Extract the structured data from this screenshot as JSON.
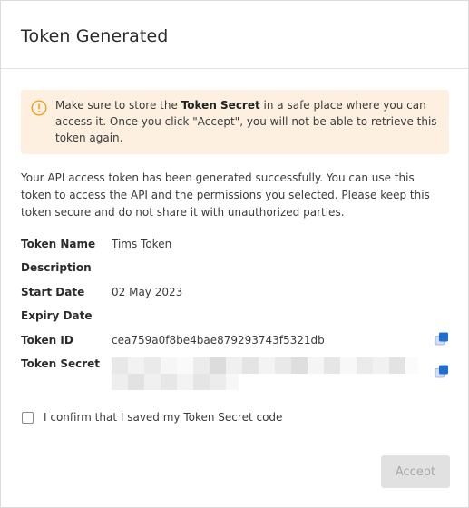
{
  "dialog": {
    "title": "Token Generated"
  },
  "warning": {
    "icon": "warning-circle-icon",
    "color": "#f0a020",
    "background": "#fdf0e0",
    "text_before": "Make sure to store the ",
    "text_bold": "Token Secret",
    "text_after": " in a safe place where you can access it. Once you click \"Accept\", you will not be able to retrieve this token again."
  },
  "intro": "Your API access token has been generated successfully. You can use this token to access the API and the permissions you selected. Please keep this token secure and do not share it with unauthorized parties.",
  "fields": {
    "token_name": {
      "label": "Token Name",
      "value": "Tims Token"
    },
    "description": {
      "label": "Description",
      "value": ""
    },
    "start_date": {
      "label": "Start Date",
      "value": "02 May 2023"
    },
    "expiry_date": {
      "label": "Expiry Date",
      "value": ""
    },
    "token_id": {
      "label": "Token ID",
      "value": "cea759a0f8be4bae879293743f5321db"
    },
    "token_secret": {
      "label": "Token Secret",
      "value": ""
    }
  },
  "copy_icon": {
    "name": "copy-icon",
    "accent": "#1f6fd1"
  },
  "confirm": {
    "label": "I confirm that I saved my Token Secret code",
    "checked": false
  },
  "accept_button": {
    "label": "Accept",
    "disabled": true
  }
}
